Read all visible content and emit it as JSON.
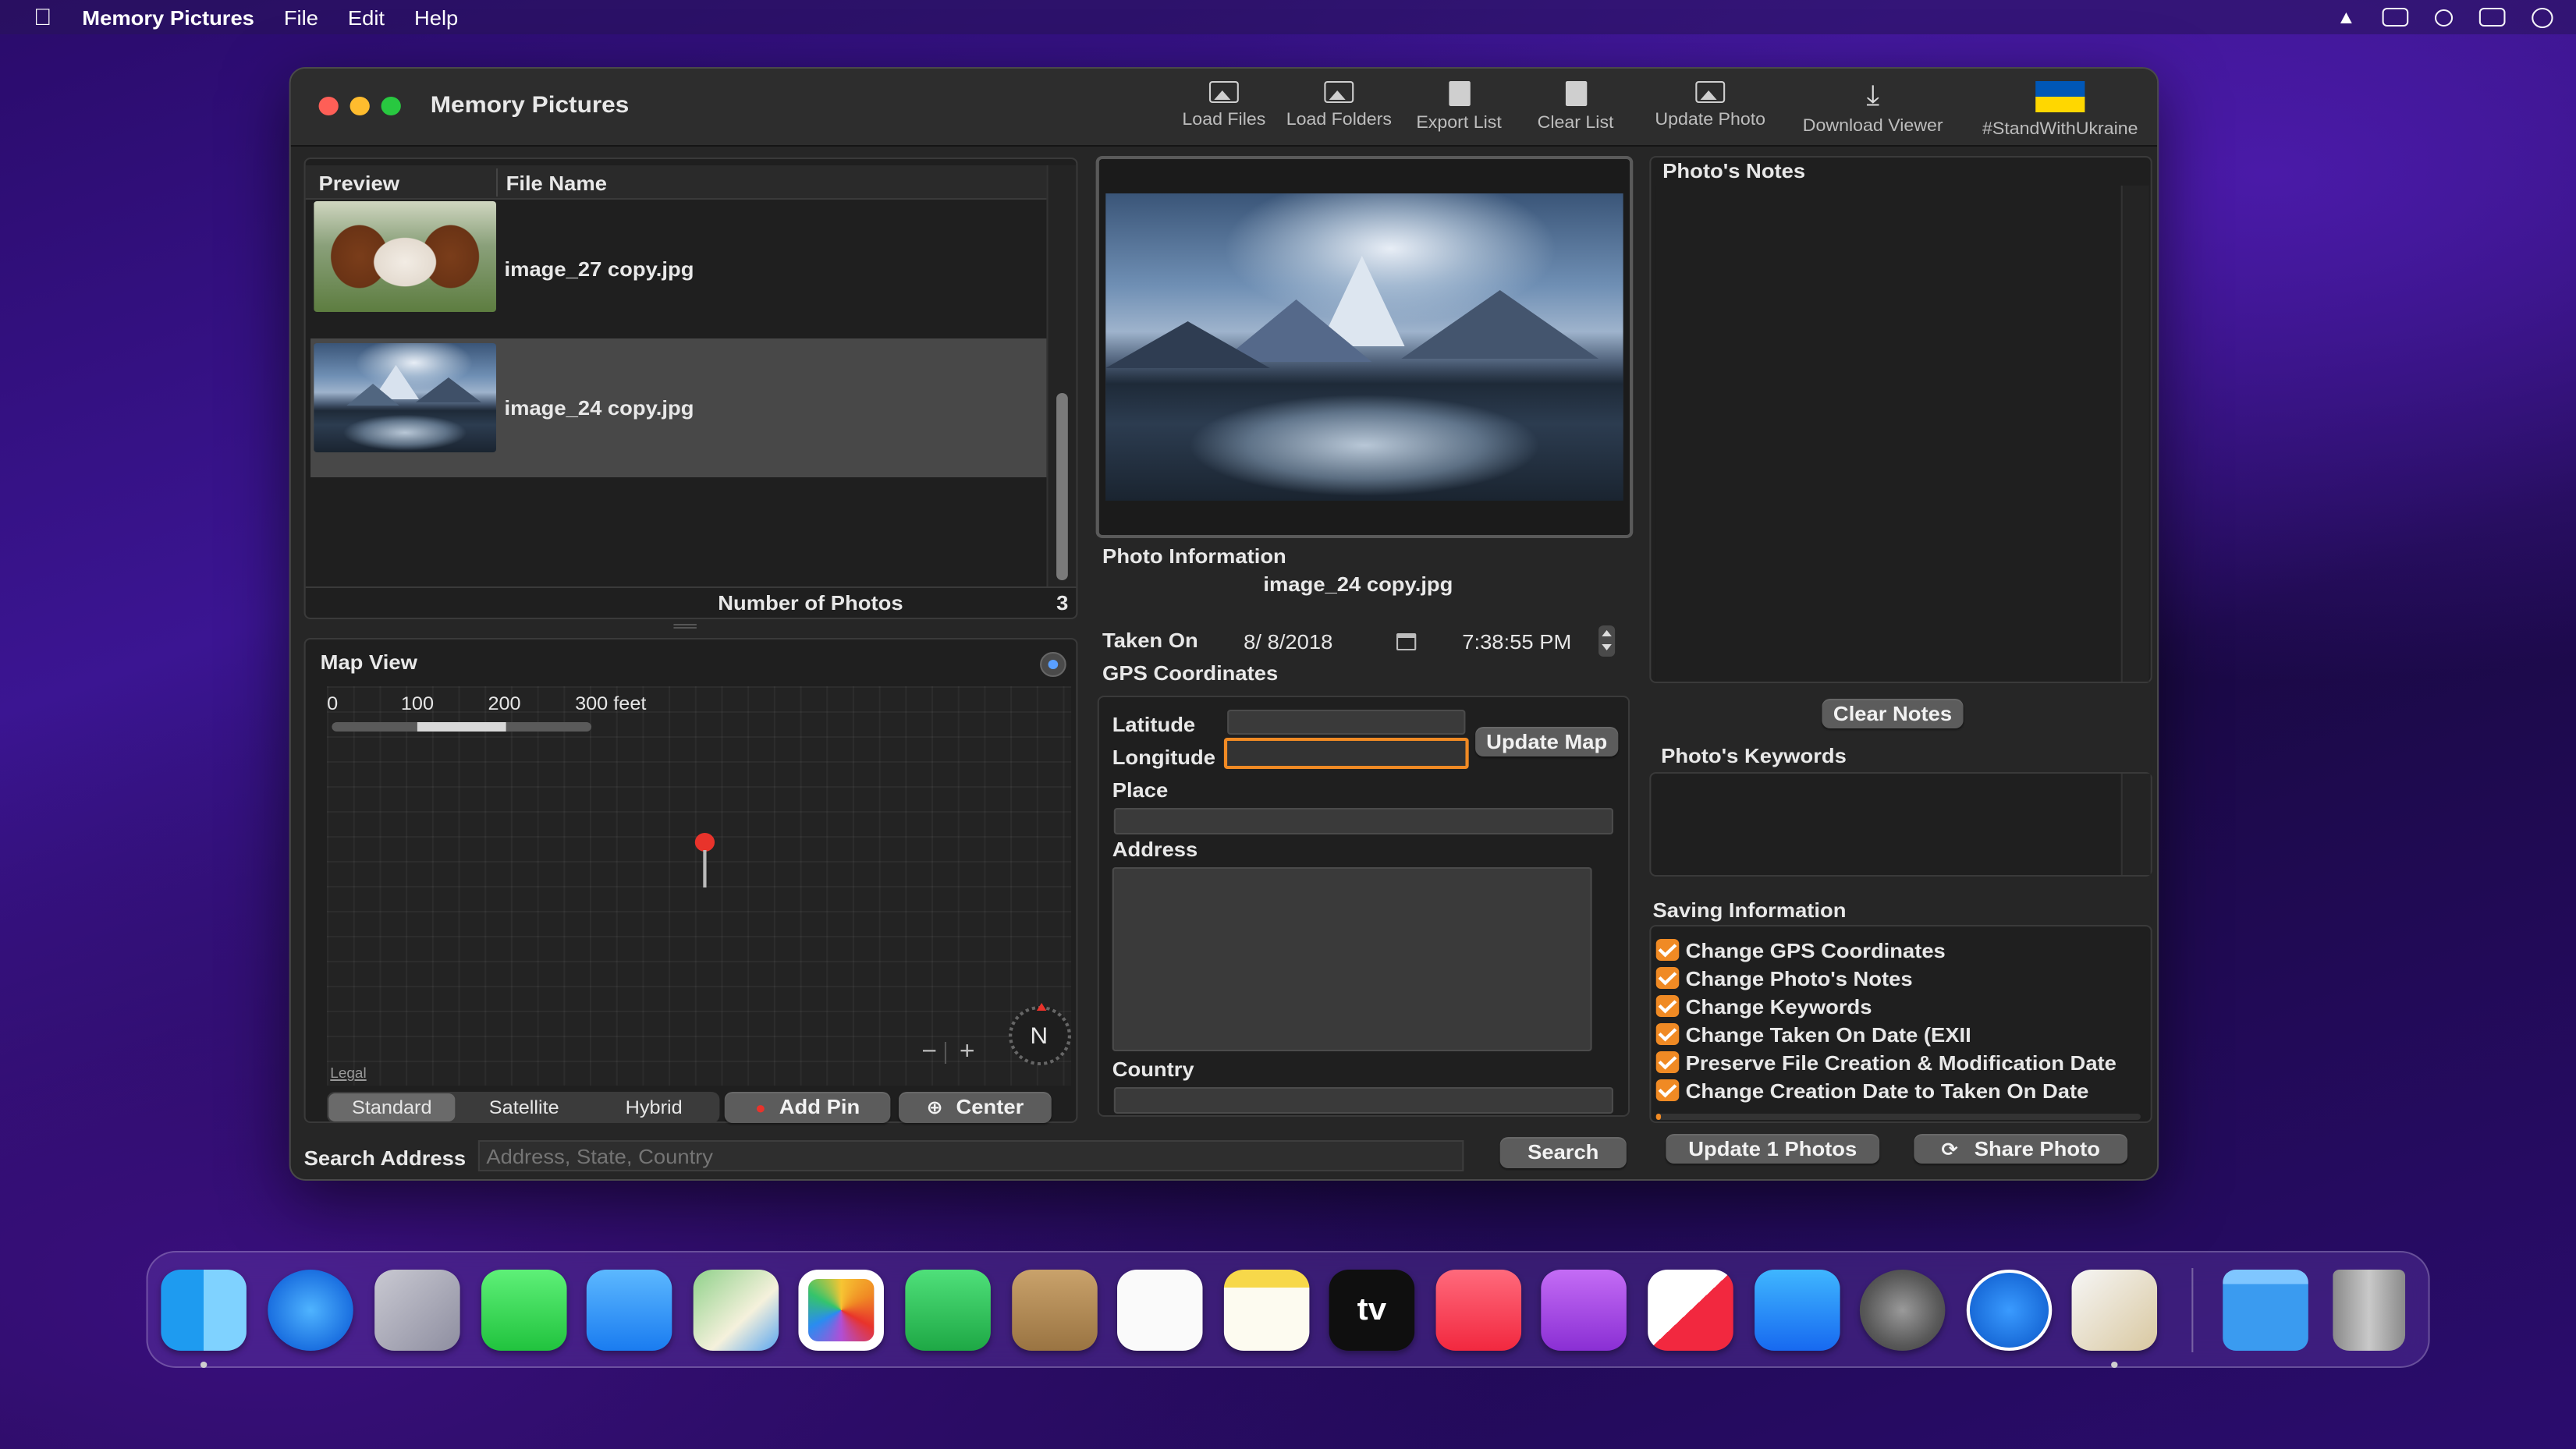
{
  "menubar": {
    "app_name": "Memory Pictures",
    "items": [
      "File",
      "Edit",
      "Help"
    ]
  },
  "window": {
    "title": "Memory Pictures",
    "toolbar": {
      "load_files": "Load Files",
      "load_folders": "Load Folders",
      "export_list": "Export List",
      "clear_list": "Clear List",
      "update_photo": "Update Photo",
      "download_viewer": "Download Viewer",
      "stand_with_ukraine": "#StandWithUkraine"
    }
  },
  "file_list": {
    "columns": {
      "preview": "Preview",
      "file_name": "File Name"
    },
    "rows": [
      {
        "file_name": "image_27 copy.jpg",
        "selected": false
      },
      {
        "file_name": "image_24 copy.jpg",
        "selected": true
      }
    ],
    "count_label": "Number of Photos",
    "count_value": "3"
  },
  "map_view": {
    "title": "Map View",
    "scale_ticks": [
      "0",
      "100",
      "200",
      "300 feet"
    ],
    "legal": "Legal",
    "compass": "N",
    "zoom_out": "−",
    "zoom_in": "+",
    "modes": [
      "Standard",
      "Satellite",
      "Hybrid"
    ],
    "selected_mode": "Standard",
    "add_pin": "Add Pin",
    "center": "Center"
  },
  "search": {
    "label": "Search Address",
    "placeholder": "Address, State, Country",
    "button": "Search"
  },
  "photo_info": {
    "title": "Photo Information",
    "file_name": "image_24 copy.jpg",
    "taken_on_label": "Taken On",
    "date": "8/  8/2018",
    "time": "7:38:55 PM",
    "gps_label": "GPS Coordinates",
    "latitude_label": "Latitude",
    "longitude_label": "Longitude",
    "latitude_value": "",
    "longitude_value": "",
    "update_map": "Update Map",
    "place_label": "Place",
    "address_label": "Address",
    "country_label": "Country"
  },
  "notes": {
    "title": "Photo's Notes",
    "clear_button": "Clear Notes",
    "keywords_title": "Photo's Keywords"
  },
  "saving": {
    "title": "Saving Information",
    "options": [
      {
        "label": "Change GPS Coordinates",
        "checked": true
      },
      {
        "label": "Change Photo's Notes",
        "checked": true
      },
      {
        "label": "Change Keywords",
        "checked": true
      },
      {
        "label": "Change Taken On Date (EXII",
        "checked": true
      },
      {
        "label": "Preserve File Creation & Modification Date",
        "checked": true
      },
      {
        "label": "Change Creation Date to Taken On Date",
        "checked": true
      }
    ],
    "update_button": "Update 1 Photos",
    "share_button": "Share Photo"
  },
  "dock": {
    "apps": [
      "finder-icon",
      "safari-icon",
      "launchpad-icon",
      "messages-icon",
      "mail-icon",
      "maps-icon",
      "photos-icon",
      "facetime-icon",
      "contacts-icon",
      "reminders-icon",
      "notes-icon",
      "tv-icon",
      "music-icon",
      "podcasts-icon",
      "news-icon",
      "app-store-icon",
      "system-preferences-icon",
      "memory-pictures-icon",
      "preview-icon",
      "folder-icon",
      "trash-icon"
    ],
    "tv_label": "tv"
  },
  "colors": {
    "accent_orange": "#f08a24",
    "window_bg": "#262626",
    "panel_bg": "#1f1f1f",
    "selected_row": "#484848",
    "ukraine_blue": "#0057b7",
    "ukraine_yellow": "#ffd700"
  }
}
